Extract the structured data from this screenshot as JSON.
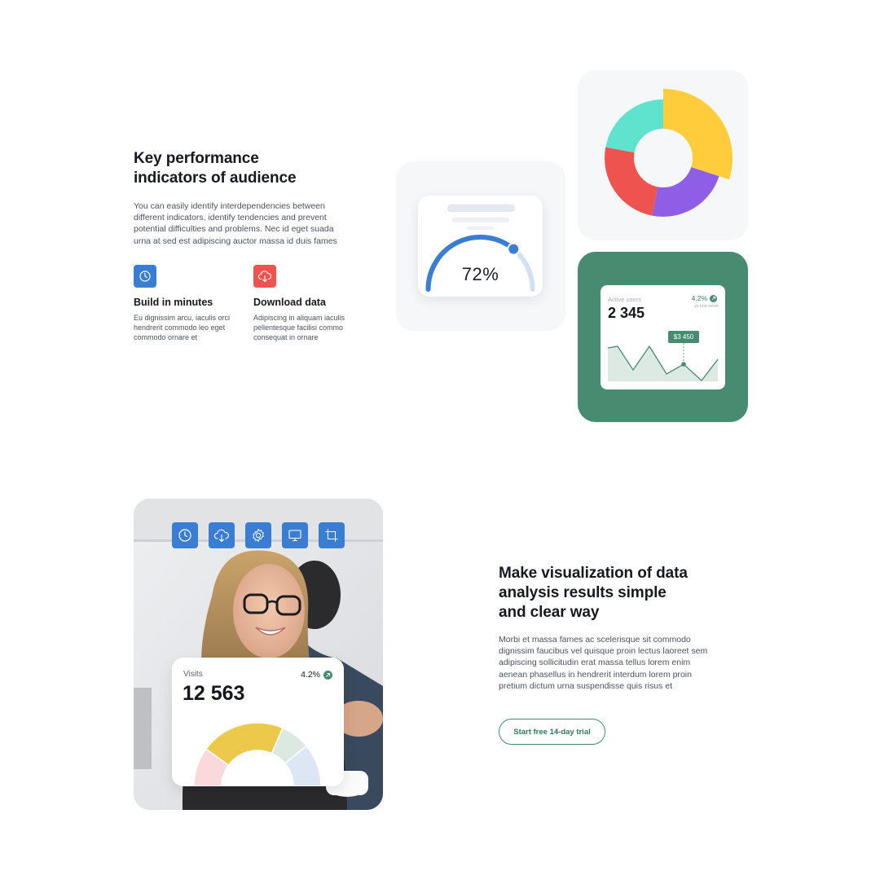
{
  "section1": {
    "heading_line1": "Key performance",
    "heading_line2": "indicators of audience",
    "paragraph": [
      "You can easily identify interdependencies between",
      "different indicators, identify tendencies and prevent",
      "potential difficulties and problems. Nec id eget suada",
      "urna at sed est adipiscing auctor massa id duis fames"
    ],
    "features": [
      {
        "title": "Build in minutes",
        "icon": "clock-icon",
        "color": "#3a7ed4",
        "text": [
          "Eu dignissim arcu, iaculis orci",
          "hendrerit commodo leo eget",
          "commodo ornare et"
        ]
      },
      {
        "title": "Download data",
        "icon": "cloud-download-icon",
        "color": "#ef5350",
        "text": [
          "Adipiscing in aliquam iaculis",
          "pellentesque facilisi commo",
          "consequat in ornare"
        ]
      }
    ]
  },
  "gauge_card": {
    "value_text": "72%",
    "value": 72
  },
  "donut_card": {
    "segments": [
      {
        "name": "yellow",
        "color": "#ffcd3c",
        "value": 30
      },
      {
        "name": "purple",
        "color": "#8e5fe6",
        "value": 23
      },
      {
        "name": "red",
        "color": "#ef5350",
        "value": 25
      },
      {
        "name": "teal",
        "color": "#5fe3cf",
        "value": 22
      }
    ]
  },
  "users_card": {
    "label": "Active users",
    "value": "2 345",
    "change": "4.2%",
    "change_sub": "vs last week",
    "tooltip": "$3 450",
    "accent": "#478c70"
  },
  "section2": {
    "heading_line1": "Make visualization of data",
    "heading_line2": "analysis results simple",
    "heading_line3": "and clear way",
    "paragraph": [
      "Morbi et massa fames ac scelerisque sit commodo",
      "dignissim faucibus vel quisque proin lectus laoreet sem",
      "adipiscing sollicitudin erat massa tellus lorem enim",
      "aenean phasellus in hendrerit interdum lorem proin",
      "pretium dictum urna suspendisse quis risus et"
    ],
    "cta_label": "Start free 14-day trial"
  },
  "photo_card": {
    "toolbar_icons": [
      "clock-icon",
      "cloud-download-icon",
      "gear-icon",
      "monitor-icon",
      "crop-icon"
    ],
    "visits_label": "Visits",
    "visits_value": "12 563",
    "visits_change": "4.2%",
    "semi_segments": [
      {
        "color": "#fbd8dc",
        "value": 20
      },
      {
        "color": "#ecc94b",
        "value": 43
      },
      {
        "color": "#dbe9e1",
        "value": 15
      },
      {
        "color": "#dde6f5",
        "value": 22
      }
    ]
  }
}
